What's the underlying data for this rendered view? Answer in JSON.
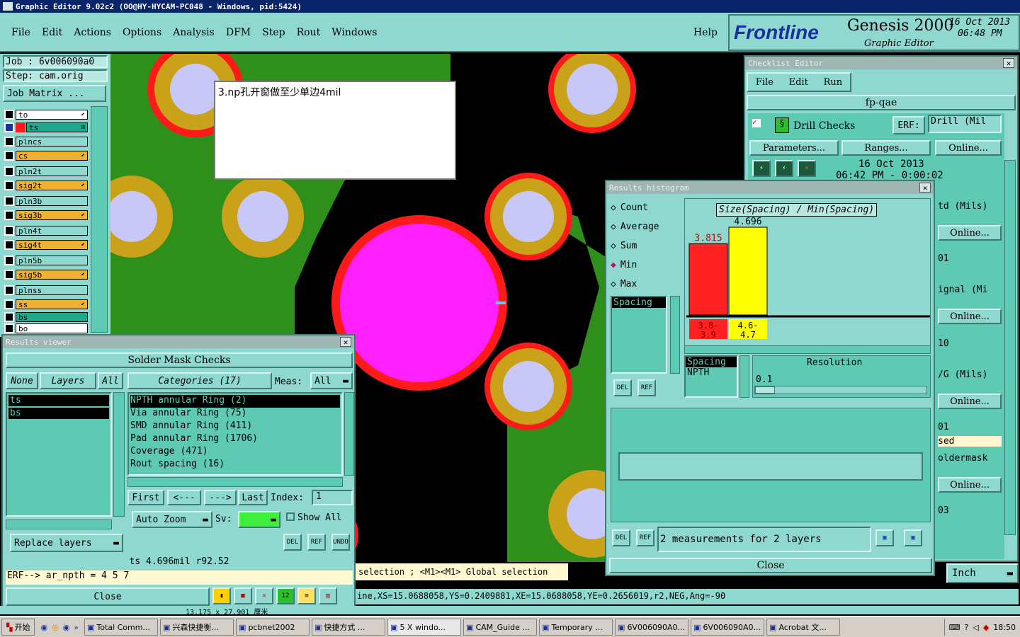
{
  "window_title": "Graphic Editor 9.02c2 (OO@HY-HYCAM-PC048 - Windows, pid:5424)",
  "menu": [
    "File",
    "Edit",
    "Actions",
    "Options",
    "Analysis",
    "DFM",
    "Step",
    "Rout",
    "Windows"
  ],
  "help_label": "Help",
  "brand": {
    "logo": "Frontline",
    "product": "Genesis 2000",
    "date": "16 Oct 2013",
    "time": "06:48 PM",
    "subtitle": "Graphic Editor"
  },
  "job_label": "Job : 6v006090a0",
  "step_label": "Step: cam.orig",
  "job_matrix": "Job Matrix ...",
  "layers": [
    {
      "name": "to",
      "color": "#ffffff",
      "mark": "⬋"
    },
    {
      "name": "ts",
      "color": "#1fa88c",
      "mark": "⊞"
    },
    {
      "name": "plncs",
      "color": "#8fd8d0",
      "mark": ""
    },
    {
      "name": "cs",
      "color": "#f0b030",
      "mark": "⬋"
    },
    {
      "name": "pln2t",
      "color": "#8fd8d0",
      "mark": ""
    },
    {
      "name": "sig2t",
      "color": "#f0b030",
      "mark": "⬋"
    },
    {
      "name": "pln3b",
      "color": "#8fd8d0",
      "mark": ""
    },
    {
      "name": "sig3b",
      "color": "#f0b030",
      "mark": "⬋"
    },
    {
      "name": "pln4t",
      "color": "#8fd8d0",
      "mark": ""
    },
    {
      "name": "sig4t",
      "color": "#f0b030",
      "mark": "⬋"
    },
    {
      "name": "pln5b",
      "color": "#8fd8d0",
      "mark": ""
    },
    {
      "name": "sig5b",
      "color": "#f0b030",
      "mark": "⬋"
    },
    {
      "name": "plnss",
      "color": "#8fd8d0",
      "mark": ""
    },
    {
      "name": "ss",
      "color": "#f0b030",
      "mark": "⬋"
    },
    {
      "name": "bs",
      "color": "#1fa88c",
      "mark": ""
    },
    {
      "name": "bo",
      "color": "#ffffff",
      "mark": ""
    }
  ],
  "note_text": "3.np孔开窗做至少单边4mil",
  "results_viewer": {
    "title": "Results viewer",
    "header": "Solder Mask Checks",
    "none": "None",
    "layers": "Layers",
    "all": "All",
    "categories": "Categories (17)",
    "meas_label": "Meas:",
    "meas_value": "All",
    "layer_list": [
      "ts",
      "bs"
    ],
    "category_list": [
      "NPTH annular Ring (2)",
      "Via annular Ring (75)",
      "SMD annular Ring (411)",
      "Pad annular Ring (1706)",
      "Coverage (471)",
      "Rout spacing (16)"
    ],
    "nav": [
      "First",
      "<---",
      "--->",
      "Last"
    ],
    "index_label": "Index:",
    "index_value": "1",
    "auto_zoom": "Auto Zoom",
    "sv_label": "Sv:",
    "show_all": "Show All",
    "replace_layers": "Replace layers",
    "del": "DEL",
    "ref": "REF",
    "undo": "UNDO",
    "status": "ts 4.696mil  r92.52",
    "erf": "ERF--> ar_npth = 4 5 7",
    "close": "Close"
  },
  "checklist": {
    "title": "Checklist Editor",
    "menu": [
      "File",
      "Edit",
      "Run"
    ],
    "name": "fp-qae",
    "drill_checks": "Drill Checks",
    "erf": "ERF:",
    "erf_value": "Drill (Mil",
    "params": "Parameters...",
    "ranges": "Ranges...",
    "online": "Online...",
    "date": "16 Oct 2013",
    "time": "06:42 PM - 0:00:02",
    "side_rows": [
      "td (Mils)",
      "Online...",
      "01",
      "ignal (Mi",
      "Online...",
      "10",
      "/G (Mils)",
      "Online...",
      "01",
      "sed",
      "oldermask",
      "Online...",
      "03"
    ]
  },
  "histogram": {
    "title": "Results histogram",
    "options": [
      "Count",
      "Average",
      "Sum",
      "Min",
      "Max"
    ],
    "selected": "Min",
    "metric_list": [
      "Spacing"
    ],
    "chart_title": "Size(Spacing) / Min(Spacing)",
    "resolution_label": "Resolution",
    "resolution_value": "0.1",
    "type_list": [
      "Spacing",
      "NPTH"
    ],
    "footer": "2 measurements for 2 layers",
    "close": "Close",
    "del": "DEL",
    "ref": "REF"
  },
  "chart_data": {
    "type": "bar",
    "title": "Size(Spacing) / Min(Spacing)",
    "categories": [
      "3.8-3.9",
      "4.6-4.7"
    ],
    "values": [
      3.815,
      4.696
    ],
    "colors": [
      "#ff2020",
      "#ffff00"
    ],
    "value_label_colors": [
      "#cc0000",
      "#000000"
    ]
  },
  "status_bar": {
    "selection": "selection ; <M1><M1> Global selection",
    "coords": "ine,XS=15.0688058,YS=0.2409881,XE=15.0688058,YE=0.2656019,r2,NEG,Ang=-90",
    "units": "Inch",
    "sub": "13.175 x 27.901 厘米"
  },
  "taskbar": {
    "start": "开始",
    "items": [
      "Total Comm...",
      "兴森快捷衡...",
      "pcbnet2002",
      "快捷方式 ...",
      "5 X windo...",
      "CAM_Guide ...",
      "Temporary ...",
      "6V006090A0...",
      "6V006090A0...",
      "Acrobat 文..."
    ],
    "clock": "18:50"
  }
}
